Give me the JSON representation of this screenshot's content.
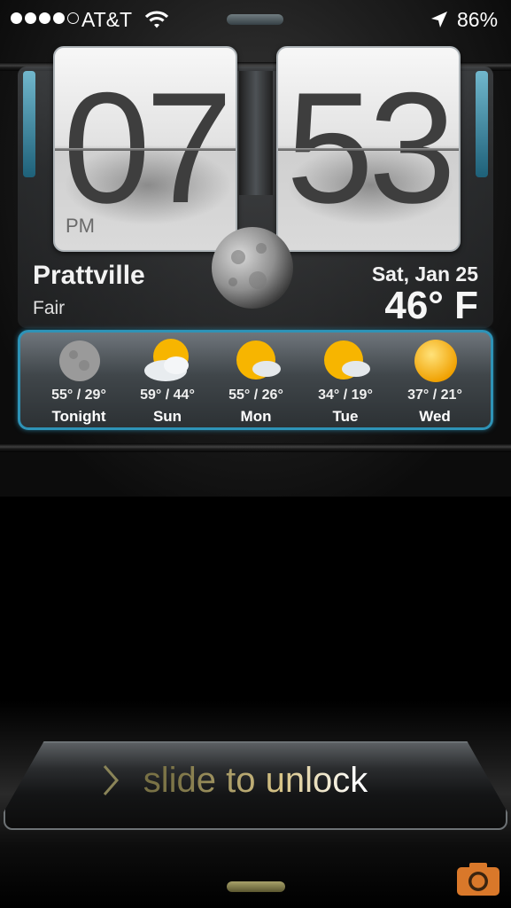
{
  "status_bar": {
    "signal_bars_filled": 4,
    "signal_bars_total": 5,
    "carrier": "AT&T",
    "wifi_icon": "wifi-icon",
    "location_icon": "location-arrow-icon",
    "battery": "86%"
  },
  "clock": {
    "hours": "07",
    "minutes": "53",
    "ampm": "PM"
  },
  "weather": {
    "city": "Prattville",
    "condition": "Fair",
    "date": "Sat, Jan 25",
    "temperature": "46° F",
    "current_icon": "moon-icon"
  },
  "forecast": [
    {
      "icon": "moon-icon",
      "range": "55° / 29°",
      "day": "Tonight"
    },
    {
      "icon": "partly-cloudy-icon",
      "range": "59° / 44°",
      "day": "Sun"
    },
    {
      "icon": "partly-cloudy-icon",
      "range": "55° / 26°",
      "day": "Mon"
    },
    {
      "icon": "partly-cloudy-icon",
      "range": "34° / 19°",
      "day": "Tue"
    },
    {
      "icon": "sun-icon",
      "range": "37° / 21°",
      "day": "Wed"
    }
  ],
  "lock": {
    "slider_text": "slide to unlock",
    "camera_icon": "camera-icon"
  },
  "colors": {
    "accent_blue": "#2e93b7",
    "camera_orange": "#d9782a",
    "sun_yellow": "#f7b500"
  }
}
